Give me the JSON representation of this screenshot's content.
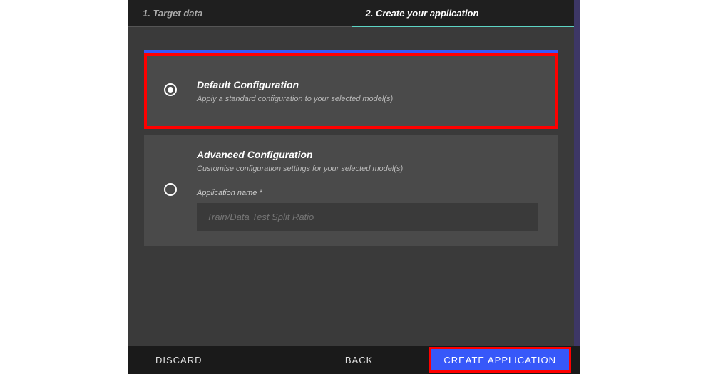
{
  "steps": {
    "step1": "1. Target data",
    "step2": "2. Create your application"
  },
  "options": {
    "default": {
      "title": "Default Configuration",
      "description": "Apply a standard configuration to your selected model(s)"
    },
    "advanced": {
      "title": "Advanced Configuration",
      "description": "Customise configuration settings for your selected model(s)",
      "fieldLabel": "Application name *",
      "fieldPlaceholder": "Train/Data Test Split Ratio"
    }
  },
  "footer": {
    "discard": "DISCARD",
    "back": "BACK",
    "create": "CREATE APPLICATION"
  }
}
